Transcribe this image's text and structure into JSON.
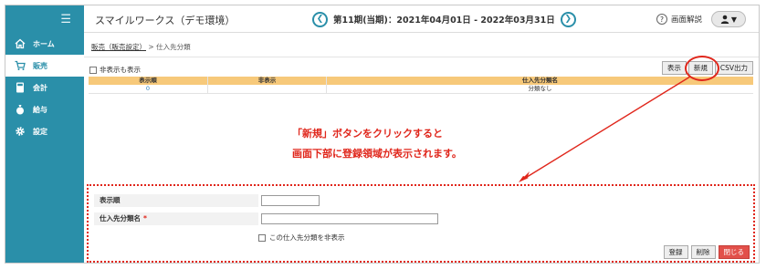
{
  "app": {
    "title": "スマイルワークス（デモ環境）",
    "period": "第11期(当期)：2021年04月01日 - 2022年03月31日",
    "help_label": "画面解説"
  },
  "sidebar": {
    "items": [
      {
        "label": "ホーム",
        "icon": "home-icon"
      },
      {
        "label": "販売",
        "icon": "cart-icon"
      },
      {
        "label": "会計",
        "icon": "calculator-icon"
      },
      {
        "label": "給与",
        "icon": "money-bag-icon"
      },
      {
        "label": "設定",
        "icon": "gear-icon"
      }
    ]
  },
  "breadcrumb": {
    "link": "販売（販売設定）",
    "separator": ">",
    "current": "仕入先分類"
  },
  "toolbar": {
    "show_hidden_label": "非表示も表示",
    "display_button": "表示",
    "new_button": "新規",
    "csv_button": "CSV出力"
  },
  "grid": {
    "headers": [
      "表示順",
      "非表示",
      "仕入先分類名"
    ],
    "rows": [
      {
        "order": "0",
        "hidden": "",
        "name": "分類なし"
      }
    ]
  },
  "annotation": {
    "line1": "「新規」ボタンをクリックすると",
    "line2": "画面下部に登録領域が表示されます。"
  },
  "form": {
    "order_label": "表示順",
    "name_label": "仕入先分類名",
    "required_mark": "*",
    "hide_checkbox_label": "この仕入先分類を非表示",
    "order_value": "",
    "name_value": "",
    "register_button": "登録",
    "delete_button": "削除",
    "close_button": "閉じる"
  },
  "colors": {
    "sidebar": "#2a8fa9",
    "grid_header": "#f7c97a",
    "annotation": "#e0261b",
    "close_button": "#e2504a"
  }
}
